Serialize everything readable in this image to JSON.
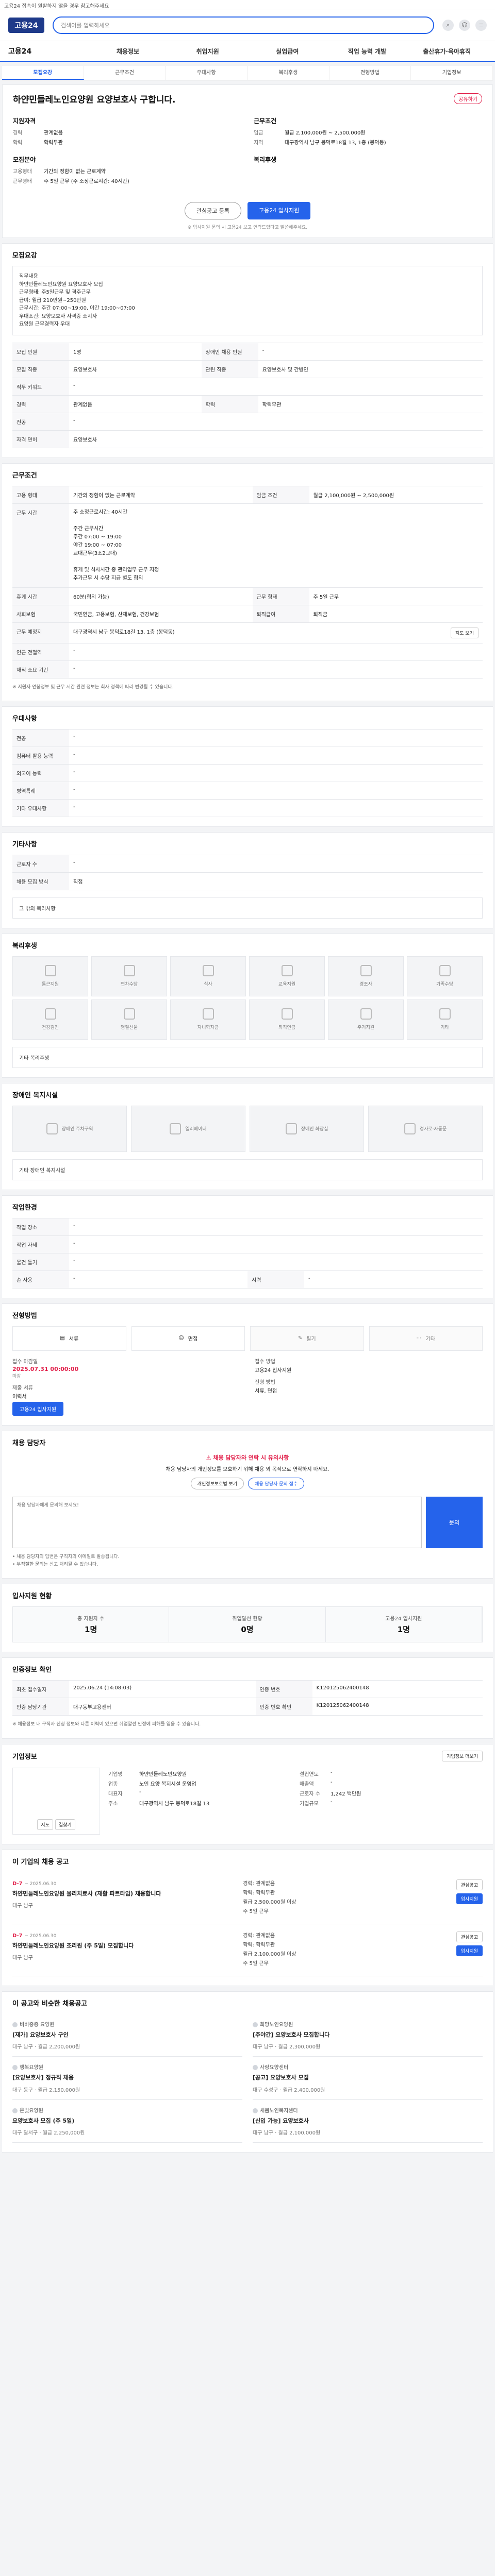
{
  "notice": "고용24 접속이 원활하지 않을 경우 참고해주세요",
  "header": {
    "logo": "고용24",
    "search_placeholder": "검색어를 입력하세요"
  },
  "gnb": [
    "고용24",
    "채용정보",
    "취업지원",
    "실업급여",
    "직업 능력 개발",
    "출산휴가·육아휴직"
  ],
  "sub_tabs": [
    "모집요강",
    "근무조건",
    "우대사항",
    "복리후생",
    "전형방법",
    "기업정보"
  ],
  "job": {
    "title": "하얀민들레노인요양원 요양보호사 구합니다.",
    "share": "공유하기",
    "left_label": "지원자격",
    "left_rows": [
      {
        "k": "경력",
        "v": "관계없음"
      },
      {
        "k": "학력",
        "v": "학력무관"
      }
    ],
    "left_label2": "모집분야",
    "left_rows2": [
      {
        "k": "고용형태",
        "v": "기간의 정함이 없는 근로계약"
      },
      {
        "k": "근무형태",
        "v": "주 5일 근무 (주 소정근로시간: 40시간)"
      }
    ],
    "right_label": "근무조건",
    "right_rows": [
      {
        "k": "임금",
        "v": "월급 2,100,000원 ~ 2,500,000원"
      },
      {
        "k": "지역",
        "v": "대구광역시 남구 봉덕로18길 13, 1층 (봉덕동)"
      }
    ],
    "right_label2": "복리후생",
    "btn_interest": "관심공고 등록",
    "btn_apply": "고용24 입사지원",
    "fine": "※ 입사지원 문의 시 고용24 보고 연락드렸다고 말씀해주세요."
  },
  "recruit": {
    "heading": "모집요강",
    "desc": "직무내용\n하얀민들레노인요양원 요양보호사 모집\n근무형태: 주5일근무 및 격주근무\n급여: 월급 210만원~250만원\n근무시간: 주간 07:00~19:00, 야간 19:00~07:00\n우대조건: 요양보호사 자격증 소지자\n요양원 근무경력자 우대",
    "rows": [
      {
        "h": "모집 인원",
        "v": "1명",
        "h2": "장애인 채용 인원",
        "v2": "-"
      },
      {
        "h": "모집 직종",
        "v": "요양보호사",
        "h2": "관련 직종",
        "v2": "요양보호사 및 간병인"
      },
      {
        "h": "직무 키워드",
        "v": "-",
        "h2": "",
        "v2": ""
      },
      {
        "h": "경력",
        "v": "관계없음",
        "h2": "학력",
        "v2": "학력무관"
      },
      {
        "h": "전공",
        "v": "-",
        "h2": "",
        "v2": ""
      },
      {
        "h": "자격 면허",
        "v": "요양보호사",
        "h2": "",
        "v2": ""
      }
    ]
  },
  "conditions": {
    "heading": "근무조건",
    "rows": [
      {
        "h": "고용 형태",
        "v": "기간의 정함이 없는 근로계약",
        "h2": "임금 조건",
        "v2": "월급 2,100,000원 ~ 2,500,000원"
      },
      {
        "h": "근무 시간",
        "v": "주 소정근로시간: 40시간\n\n주간 근무시간\n주간 07:00 ~ 19:00\n야간 19:00 ~ 07:00\n교대근무(3조2교대)\n\n휴게 및 식사시간 중 관리업무 근무 지정\n추가근무 시 수당 지급 별도 협의",
        "h2": "",
        "v2": ""
      },
      {
        "h": "휴게 시간",
        "v": "60분(협의 가능)",
        "h2": "근무 형태",
        "v2": "주 5일 근무"
      },
      {
        "h": "사회보험",
        "v": "국민연금, 고용보험, 산재보험, 건강보험",
        "h2": "퇴직급여",
        "v2": "퇴직금"
      },
      {
        "h": "근무 예정지",
        "v": "대구광역시 남구 봉덕로18길 13, 1층 (봉덕동)",
        "h2": "",
        "v2": ""
      },
      {
        "h": "인근 전철역",
        "v": "-",
        "h2": "",
        "v2": ""
      },
      {
        "h": "재직 소요 기간",
        "v": "-",
        "h2": "",
        "v2": ""
      }
    ],
    "map_btn": "지도 보기",
    "note": "※ 지원자 연봉정보 및 근무 시간 관련 정보는 회사 정책에 따라 변경될 수 있습니다."
  },
  "prefs": {
    "heading": "우대사항",
    "rows": [
      {
        "h": "전공",
        "v": "-"
      },
      {
        "h": "컴퓨터 활용 능력",
        "v": "-"
      },
      {
        "h": "외국어 능력",
        "v": "-"
      },
      {
        "h": "병역특례",
        "v": "-"
      },
      {
        "h": "기타 우대사항",
        "v": "-"
      }
    ]
  },
  "etc": {
    "heading": "기타사항",
    "rows": [
      {
        "h": "근로자 수",
        "v": "-"
      },
      {
        "h": "채용 모집 방식",
        "v": "직접"
      }
    ],
    "box": "그 밖의 복리사항"
  },
  "welfare": {
    "heading": "복리후생",
    "items": [
      "통근지원",
      "연차수당",
      "식사",
      "교육지원",
      "경조사",
      "가족수당",
      "건강검진",
      "명절선물",
      "자녀학자금",
      "퇴직연금",
      "주거지원",
      "기타"
    ],
    "box": "기타 복리후생"
  },
  "disabled": {
    "heading": "장애인 복지시설",
    "items": [
      "장애인 주차구역",
      "엘리베이터",
      "장애인 화장실",
      "경사로·자동문"
    ],
    "box": "기타 장애인 복지시설"
  },
  "selection": {
    "heading": "작업환경",
    "rows": [
      {
        "h": "작업 장소",
        "v": "-",
        "h2": "",
        "v2": ""
      },
      {
        "h": "작업 자세",
        "v": "-",
        "h2": "",
        "v2": ""
      },
      {
        "h": "물건 들기",
        "v": "-",
        "h2": "",
        "v2": ""
      },
      {
        "h": "손 사용",
        "v": "-",
        "h2": "시력",
        "v2": "-"
      }
    ]
  },
  "method": {
    "heading": "전형방법",
    "items": [
      {
        "label": "서류",
        "on": true
      },
      {
        "label": "면접",
        "on": true
      },
      {
        "label": "필기",
        "on": false
      },
      {
        "label": "기타",
        "on": false
      }
    ]
  },
  "apply": {
    "deadline_label": "접수 마감일",
    "deadline": "2025.07.31 00:00:00",
    "deadline_note": "마감",
    "method_label": "접수 방법",
    "method": "고용24 입사지원",
    "docs_label": "제출 서류",
    "docs": "이력서",
    "qual_label": "전형 방법",
    "qual": "서류, 면접",
    "apply_btn": "고용24 입사지원"
  },
  "manager": {
    "heading": "채용 담당자",
    "warn_title": "채용 담당자와 연락 시 유의사항",
    "warn_body": "채용 담당자의 개인정보를 보호하기 위해 채용 외 목적으로 연락하지 마세요.",
    "btn1": "개인정보보호법 보기",
    "btn2": "채용 담당자 문의 접수",
    "inquiry_placeholder": "채용 담당자에게 문의해 보세요!",
    "ask_btn": "문의",
    "notes": [
      "• 채용 담당자의 답변은 구직자의 이메일로 발송됩니다.",
      "• 부적절한 문의는 신고 처리될 수 있습니다."
    ]
  },
  "status": {
    "heading": "입사지원 현황",
    "cells": [
      {
        "t": "총 지원자 수",
        "n": "1명"
      },
      {
        "t": "취업알선 현황",
        "n": "0명"
      },
      {
        "t": "고용24 입사지원",
        "n": "1명"
      }
    ]
  },
  "info": {
    "heading": "인증정보 확인",
    "rows": [
      {
        "h": "최초 접수일자",
        "v": "2025.06.24 (14:08:03)",
        "h2": "인증 번호",
        "v2": "K120125062400148"
      },
      {
        "h": "인증 담당기관",
        "v": "대구동부고용센터",
        "h2": "인증 번호 확인",
        "v2": "K120125062400148"
      }
    ],
    "note": "※ 채용정보 내 구직자 신청 정보와 다른 이력이 있으면 취업알선 안정에 피해를 입을 수 있습니다."
  },
  "company": {
    "heading": "기업정보",
    "more": "기업정보 더보기",
    "map_btns": [
      "지도",
      "길찾기"
    ],
    "rows": [
      {
        "k": "기업명",
        "v": "하얀민들레노인요양원"
      },
      {
        "k": "업종",
        "v": "노인 요양 복지시설 운영업"
      },
      {
        "k": "대표자",
        "v": "-"
      },
      {
        "k": "주소",
        "v": "대구광역시 남구 봉덕로18길 13"
      }
    ],
    "rows2": [
      {
        "k": "설립연도",
        "v": "-"
      },
      {
        "k": "매출액",
        "v": "-"
      },
      {
        "k": "근로자 수",
        "v": "1,242 백만원"
      },
      {
        "k": "기업규모",
        "v": "-"
      }
    ]
  },
  "company_jobs": {
    "heading": "이 기업의 채용 공고",
    "items": [
      {
        "dday": "D-7",
        "date": "~ 2025.06.30",
        "title": "하얀민들레노인요양원 물리치료사 (재활 파트타임) 채용합니다",
        "loc": "대구 남구",
        "mid": [
          "경력: 관계없음",
          "학력: 학력무관",
          "월급 2,500,000원 이상",
          "주 5일 근무"
        ],
        "btns": [
          "관심공고",
          "입사지원"
        ]
      },
      {
        "dday": "D-7",
        "date": "~ 2025.06.30",
        "title": "하얀민들레노인요양원 조리원 (주 5일) 모집합니다",
        "loc": "대구 남구",
        "mid": [
          "경력: 관계없음",
          "학력: 학력무관",
          "월급 2,100,000원 이상",
          "주 5일 근무"
        ],
        "btns": [
          "관심공고",
          "입사지원"
        ]
      }
    ]
  },
  "recommend": {
    "heading": "이 공고와 비슷한 채용공고",
    "items": [
      {
        "cname": "비비중증 요양원",
        "title": "[재가] 요양보호사 구인",
        "meta": "대구 남구 · 월급 2,200,000원"
      },
      {
        "cname": "희망노인요양원",
        "title": "[주야간] 요양보호사 모집합니다",
        "meta": "대구 남구 · 월급 2,300,000원"
      },
      {
        "cname": "행복요양원",
        "title": "[요양보호사] 정규직 채용",
        "meta": "대구 동구 · 월급 2,150,000원"
      },
      {
        "cname": "사랑요양센터",
        "title": "[공고] 요양보호사 모집",
        "meta": "대구 수성구 · 월급 2,400,000원"
      },
      {
        "cname": "은빛요양원",
        "title": "요양보호사 모집 (주 5일)",
        "meta": "대구 달서구 · 월급 2,250,000원"
      },
      {
        "cname": "새봄노인복지센터",
        "title": "[신입 가능] 요양보호사",
        "meta": "대구 남구 · 월급 2,100,000원"
      }
    ]
  }
}
